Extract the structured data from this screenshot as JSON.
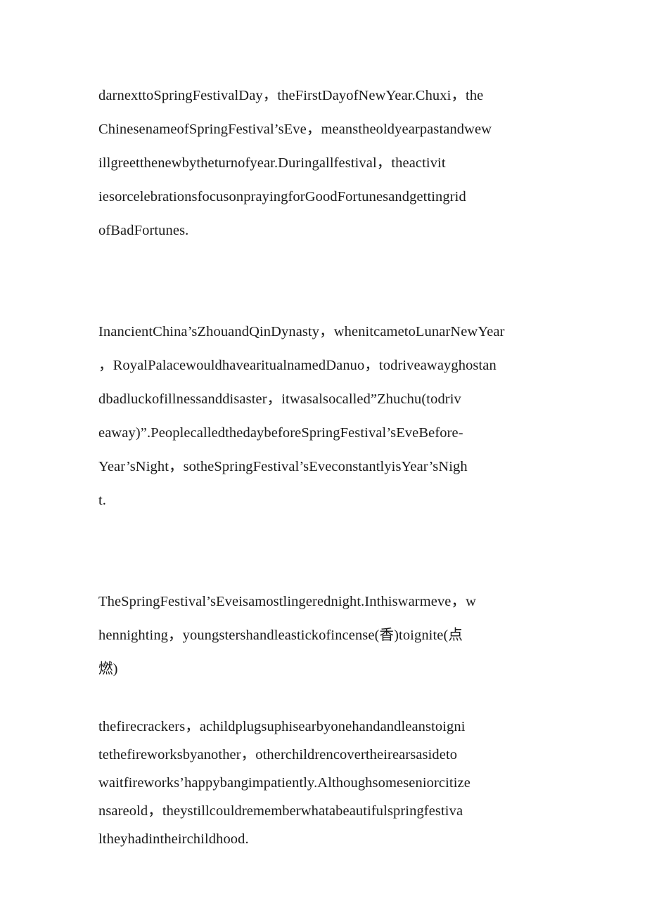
{
  "document": {
    "page_background": "#ffffff",
    "text_color": "#1a1a1a",
    "blocks": [
      {
        "id": "paragraph-1",
        "leading": "normal",
        "lines": [
          "darnexttoSpringFestivalDay，theFirstDayofNewYear.Chuxi，the",
          "ChinesenameofSpringFestival’sEve，meanstheoldyearpastandwew",
          "illgreetthenewbytheturnofyear.Duringallfestival，theactivit",
          "iesorcelebrationsfocusonprayingforGoodFortunesandgettingrid",
          "ofBadFortunes."
        ]
      },
      {
        "id": "paragraph-2",
        "leading": "normal",
        "lines": [
          "InancientChina’sZhouandQinDynasty，whenitcametoLunarNewYear",
          "，RoyalPalacewouldhavearitualnamedDanuo，todriveawayghostan",
          "dbadluckofillnessanddisaster，itwasalsocalled”Zhuchu(todriv",
          "eaway)”.PeoplecalledthedaybeforeSpringFestival’sEveBefore-",
          "Year’sNight，sotheSpringFestival’sEveconstantlyisYear’sNigh",
          "t."
        ]
      },
      {
        "id": "paragraph-3",
        "leading": "normal",
        "lines": [
          "TheSpringFestival’sEveisamostlingerednight.Inthiswarmeve，w",
          "hennighting，youngstershandleastickofincense(香)toignite(点",
          "燃)"
        ]
      },
      {
        "id": "paragraph-4",
        "leading": "tight",
        "lines": [
          "thefirecrackers，achildplugsuphisearbyonehandandleanstoigni",
          "tethefireworksbyanother，otherchildrencovertheirearsasideto",
          "waitfireworks’happybangimpatiently.Althoughsomeseniorcitize",
          "nsareold，theystillcouldrememberwhatabeautifulspringfestiva",
          "ltheyhadintheirchildhood."
        ]
      }
    ]
  }
}
